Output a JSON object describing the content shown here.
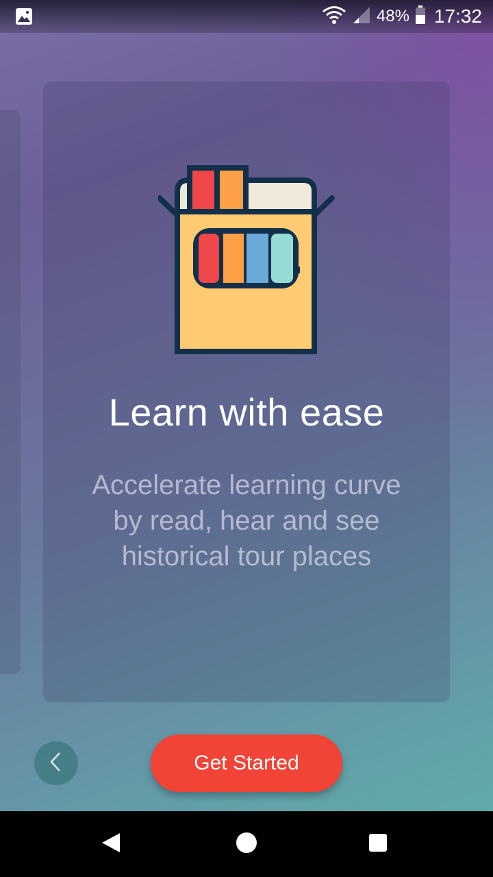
{
  "status_bar": {
    "notification_icon": "image-icon",
    "wifi_icon": "wifi-icon",
    "signal_icon": "cell-signal-icon",
    "battery_icon": "battery-icon",
    "battery_percent": "48%",
    "time": "17:32"
  },
  "onboarding": {
    "illustration_icon": "pencil-box-icon",
    "title": "Learn with ease",
    "description": "Accelerate learning curve by read, hear and see historical tour places"
  },
  "actions": {
    "back_icon": "chevron-left-icon",
    "get_started_label": "Get Started"
  },
  "nav_bar": {
    "back_icon": "triangle-back-icon",
    "home_icon": "circle-home-icon",
    "recents_icon": "square-recents-icon"
  },
  "colors": {
    "accent": "#f14336",
    "title_text": "#ffffff"
  }
}
